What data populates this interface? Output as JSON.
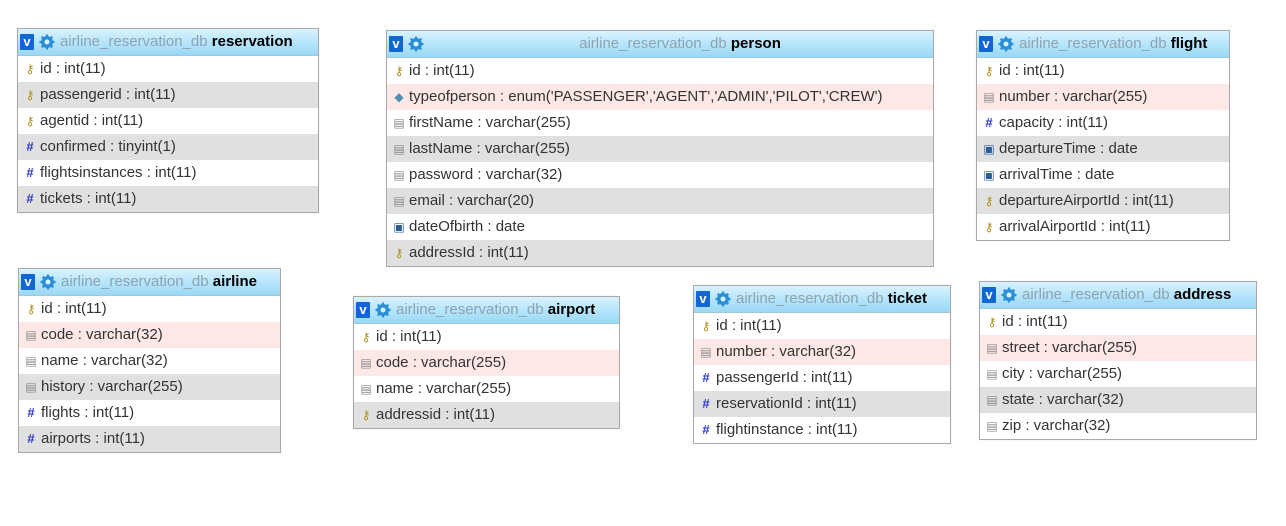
{
  "icons": {
    "v": "v",
    "key": "⚷",
    "hash": "#",
    "doc": "▤",
    "cal": "▣",
    "enum": "◆"
  },
  "tables": {
    "reservation": {
      "db": "airline_reservation_db",
      "name": "reservation",
      "columns": [
        {
          "text": "id : int(11)"
        },
        {
          "text": "passengerid : int(11)"
        },
        {
          "text": "agentid : int(11)"
        },
        {
          "text": "confirmed : tinyint(1)"
        },
        {
          "text": "flightsinstances : int(11)"
        },
        {
          "text": "tickets : int(11)"
        }
      ]
    },
    "person": {
      "db": "airline_reservation_db",
      "name": "person",
      "columns": [
        {
          "text": "id : int(11)"
        },
        {
          "text": "typeofperson : enum('PASSENGER','AGENT','ADMIN','PILOT','CREW')"
        },
        {
          "text": "firstName : varchar(255)"
        },
        {
          "text": "lastName : varchar(255)"
        },
        {
          "text": "password : varchar(32)"
        },
        {
          "text": "email : varchar(20)"
        },
        {
          "text": "dateOfbirth : date"
        },
        {
          "text": "addressId : int(11)"
        }
      ]
    },
    "flight": {
      "db": "airline_reservation_db",
      "name": "flight",
      "columns": [
        {
          "text": "id : int(11)"
        },
        {
          "text": "number : varchar(255)"
        },
        {
          "text": "capacity : int(11)"
        },
        {
          "text": "departureTime : date"
        },
        {
          "text": "arrivalTime : date"
        },
        {
          "text": "departureAirportId : int(11)"
        },
        {
          "text": "arrivalAirportId : int(11)"
        }
      ]
    },
    "airline": {
      "db": "airline_reservation_db",
      "name": "airline",
      "columns": [
        {
          "text": "id : int(11)"
        },
        {
          "text": "code : varchar(32)"
        },
        {
          "text": "name : varchar(32)"
        },
        {
          "text": "history : varchar(255)"
        },
        {
          "text": "flights : int(11)"
        },
        {
          "text": "airports : int(11)"
        }
      ]
    },
    "airport": {
      "db": "airline_reservation_db",
      "name": "airport",
      "columns": [
        {
          "text": "id : int(11)"
        },
        {
          "text": "code : varchar(255)"
        },
        {
          "text": "name : varchar(255)"
        },
        {
          "text": "addressid : int(11)"
        }
      ]
    },
    "ticket": {
      "db": "airline_reservation_db",
      "name": "ticket",
      "columns": [
        {
          "text": "id : int(11)"
        },
        {
          "text": "number : varchar(32)"
        },
        {
          "text": "passengerId : int(11)"
        },
        {
          "text": "reservationId : int(11)"
        },
        {
          "text": "flightinstance : int(11)"
        }
      ]
    },
    "address": {
      "db": "airline_reservation_db",
      "name": "address",
      "columns": [
        {
          "text": "id : int(11)"
        },
        {
          "text": "street : varchar(255)"
        },
        {
          "text": "city : varchar(255)"
        },
        {
          "text": "state : varchar(32)"
        },
        {
          "text": "zip : varchar(32)"
        }
      ]
    }
  }
}
